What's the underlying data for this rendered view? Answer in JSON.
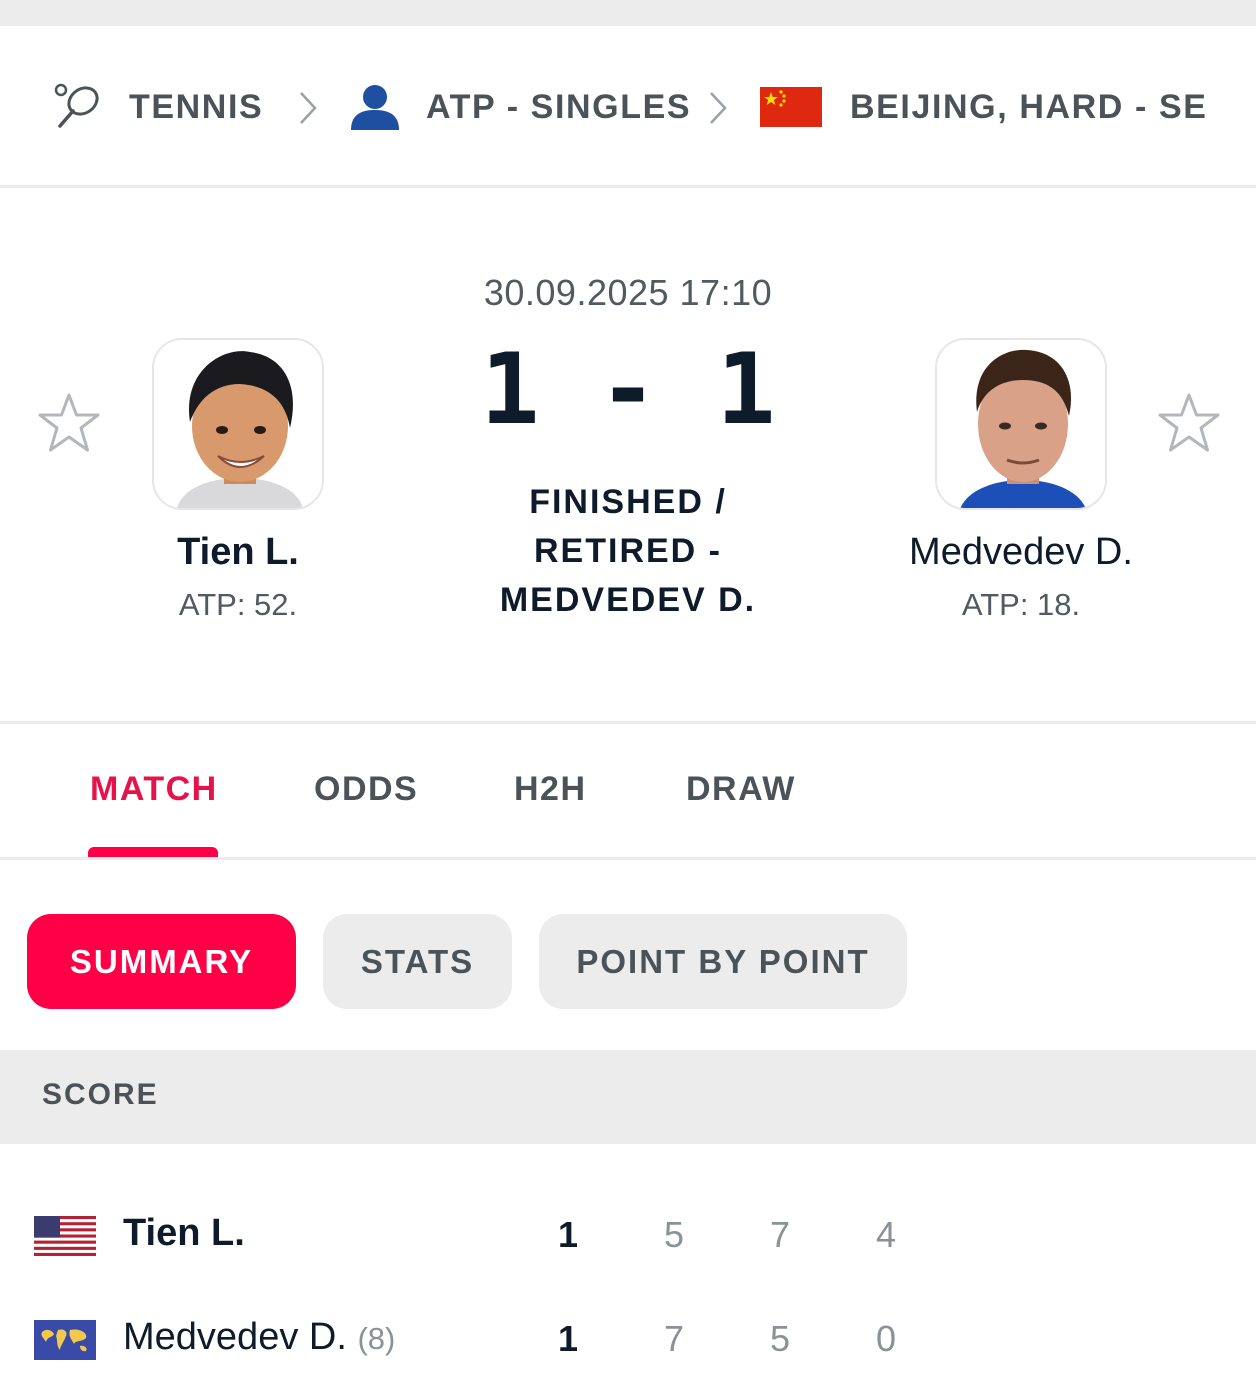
{
  "breadcrumb": {
    "sport": "TENNIS",
    "category": "ATP - SINGLES",
    "tournament": "BEIJING, HARD - SEMI-FINALS"
  },
  "match": {
    "datetime": "30.09.2025 17:10",
    "score": "1 - 1",
    "status": "FINISHED / RETIRED - MEDVEDEV D."
  },
  "players": [
    {
      "name": "Tien L.",
      "rank": "ATP: 52."
    },
    {
      "name": "Medvedev D.",
      "rank": "ATP: 18."
    }
  ],
  "tabs": [
    "MATCH",
    "ODDS",
    "H2H",
    "DRAW"
  ],
  "active_tab": "MATCH",
  "subtabs": [
    "SUMMARY",
    "STATS",
    "POINT BY POINT"
  ],
  "active_subtab": "SUMMARY",
  "score_section": {
    "title": "SCORE",
    "rows": [
      {
        "name": "Tien L.",
        "seed": "",
        "flag": "usa-flag",
        "total": "1",
        "sets": [
          "5",
          "7",
          "4"
        ]
      },
      {
        "name": "Medvedev D.",
        "seed": "(8)",
        "flag": "world-flag",
        "total": "1",
        "sets": [
          "7",
          "5",
          "0"
        ]
      }
    ]
  },
  "colors": {
    "accent": "#ff0046",
    "accent_text": "#e6134b",
    "dark_text": "#0d1b2a",
    "muted_text": "#4b5358",
    "light_bg": "#ececec"
  }
}
